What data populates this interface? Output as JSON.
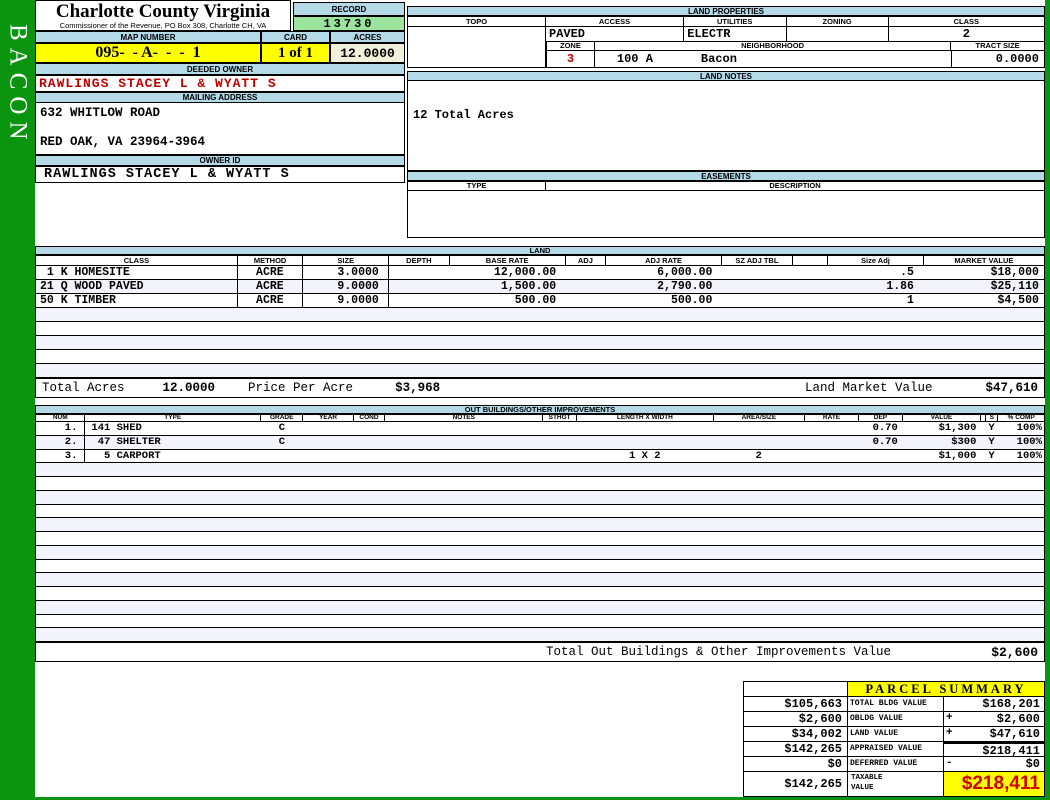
{
  "sidebar": {
    "district": "BACON"
  },
  "header": {
    "county_title": "Charlotte County Virginia",
    "commissioner_line": "Commissioner of the Revenue, PO Box 308, Charlotte CH, VA",
    "record_label": "RECORD",
    "record_value": "13730",
    "map_number_label": "MAP NUMBER",
    "map_number_value": "095-  - A-  -  -  1",
    "card_label": "CARD",
    "card_value": "1 of 1",
    "acres_label": "ACRES",
    "acres_value": "12.0000"
  },
  "owner": {
    "deeded_owner_label": "DEEDED OWNER",
    "deeded_owner": "RAWLINGS STACEY L & WYATT S",
    "mailing_address_label": "MAILING ADDRESS",
    "address_line1": "632 WHITLOW ROAD",
    "address_line2": "RED OAK, VA 23964-3964",
    "owner_id_label": "OWNER ID",
    "owner_id": "RAWLINGS STACEY L & WYATT S"
  },
  "land_properties": {
    "title": "LAND PROPERTIES",
    "topo_label": "TOPO",
    "topo": "",
    "access_label": "ACCESS",
    "access": "PAVED",
    "utilities_label": "UTILITIES",
    "utilities": "ELECTR",
    "zoning_label": "ZONING",
    "zoning": "",
    "class_label": "CLASS",
    "class": "2",
    "zone_label": "ZONE",
    "zone": "3",
    "neighborhood_label": "NEIGHBORHOOD",
    "neighborhood_code": "100 A",
    "neighborhood_name": "Bacon",
    "tract_size_label": "TRACT SIZE",
    "tract_size": "0.0000"
  },
  "land_notes": {
    "title": "LAND NOTES",
    "note": "12 Total Acres"
  },
  "easements": {
    "title": "EASEMENTS",
    "type_label": "TYPE",
    "description_label": "DESCRIPTION"
  },
  "land": {
    "title": "LAND",
    "columns": [
      "CLASS",
      "METHOD",
      "SIZE",
      "DEPTH",
      "BASE RATE",
      "ADJ",
      "ADJ RATE",
      "SZ ADJ TBL",
      "",
      "Size Adj",
      "MARKET VALUE"
    ],
    "rows": [
      {
        "class": " 1 K HOMESITE",
        "method": "ACRE",
        "size": "3.0000",
        "depth": "",
        "base_rate": "12,000.00",
        "adj": "",
        "adj_rate": "6,000.00",
        "sz_adj_tbl": "",
        "blank": "",
        "size_adj": ".5",
        "market_value": "$18,000"
      },
      {
        "class": "21 Q WOOD PAVED",
        "method": "ACRE",
        "size": "9.0000",
        "depth": "",
        "base_rate": "1,500.00",
        "adj": "",
        "adj_rate": "2,790.00",
        "sz_adj_tbl": "",
        "blank": "",
        "size_adj": "1.86",
        "market_value": "$25,110"
      },
      {
        "class": "50 K TIMBER",
        "method": "ACRE",
        "size": "9.0000",
        "depth": "",
        "base_rate": "500.00",
        "adj": "",
        "adj_rate": "500.00",
        "sz_adj_tbl": "",
        "blank": "",
        "size_adj": "1",
        "market_value": "$4,500"
      }
    ],
    "total_acres_label": "Total Acres",
    "total_acres": "12.0000",
    "price_per_acre_label": "Price Per Acre",
    "price_per_acre": "$3,968",
    "market_value_label": "Land Market Value",
    "market_value": "$47,610"
  },
  "out_buildings": {
    "title": "OUT BUILDINGS/OTHER IMPROVEMENTS",
    "columns": [
      "NUM",
      "TYPE",
      "GRADE",
      "YEAR",
      "COND",
      "NOTES",
      "STHGT",
      "LENGTH X WIDTH",
      "AREA/SIZE",
      "RATE",
      "DEP",
      "VALUE",
      "",
      "S",
      "% COMP"
    ],
    "rows": [
      {
        "num": "1.",
        "type": "141 SHED",
        "grade": "C",
        "year": "",
        "cond": "",
        "notes": "",
        "sthgt": "",
        "length_x_width": "",
        "area_size": "",
        "rate": "",
        "dep": "0.70",
        "value": "$1,300",
        "blank": "",
        "s": "Y",
        "pct_comp": "100%"
      },
      {
        "num": "2.",
        "type": " 47 SHELTER",
        "grade": "C",
        "year": "",
        "cond": "",
        "notes": "",
        "sthgt": "",
        "length_x_width": "",
        "area_size": "",
        "rate": "",
        "dep": "0.70",
        "value": "$300",
        "blank": "",
        "s": "Y",
        "pct_comp": "100%"
      },
      {
        "num": "3.",
        "type": "  5 CARPORT",
        "grade": "",
        "year": "",
        "cond": "",
        "notes": "",
        "sthgt": "",
        "length_x_width": "1 X 2",
        "area_size": "2",
        "rate": "",
        "dep": "",
        "value": "$1,000",
        "blank": "",
        "s": "Y",
        "pct_comp": "100%"
      }
    ],
    "total_label": "Total Out Buildings & Other Improvements Value",
    "total_value": "$2,600"
  },
  "parcel_summary": {
    "title": "PARCEL SUMMARY",
    "rows": [
      {
        "left": "$105,663",
        "label": "TOTAL BLDG VALUE",
        "sign": "",
        "value": "$168,201"
      },
      {
        "left": "$2,600",
        "label": "OBLDG VALUE",
        "sign": "+",
        "value": "$2,600"
      },
      {
        "left": "$34,002",
        "label": "LAND VALUE",
        "sign": "+",
        "value": "$47,610"
      },
      {
        "left": "$142,265",
        "label": "APPRAISED VALUE",
        "sign": "",
        "value": "$218,411"
      },
      {
        "left": "$0",
        "label": "DEFERRED VALUE",
        "sign": "-",
        "value": "$0"
      }
    ],
    "taxable": {
      "left": "$142,265",
      "label": "TAXABLE VALUE",
      "value": "$218,411"
    }
  },
  "colors": {
    "page_green": "#0a9410",
    "header_blue": "#b4d9e7",
    "highlight_yellow": "#ffff00",
    "record_green": "#9ce49e",
    "acres_cream": "#f2efda",
    "alert_red": "#c00000",
    "alt_row": "#f2f3fb"
  }
}
